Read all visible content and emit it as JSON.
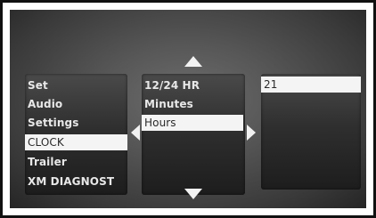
{
  "menu_left": {
    "items": [
      {
        "label": "Set",
        "selected": false
      },
      {
        "label": "Audio",
        "selected": false
      },
      {
        "label": "Settings",
        "selected": false
      },
      {
        "label": "CLOCK",
        "selected": true
      },
      {
        "label": "Trailer",
        "selected": false
      },
      {
        "label": "XM DIAGNOST",
        "selected": false
      }
    ]
  },
  "menu_middle": {
    "items": [
      {
        "label": "12/24 HR",
        "selected": false
      },
      {
        "label": "Minutes",
        "selected": false
      },
      {
        "label": "Hours",
        "selected": true
      }
    ]
  },
  "value_panel": {
    "value": "21"
  },
  "icons": {
    "up": "up-arrow-icon",
    "down": "down-arrow-icon",
    "left": "left-chevron-icon",
    "right": "right-chevron-icon"
  },
  "colors": {
    "highlight": "#f4f4f4",
    "text": "#e8e8e8",
    "selected_text": "#2a2a2a",
    "screen_bg": "#4a4a4a"
  }
}
